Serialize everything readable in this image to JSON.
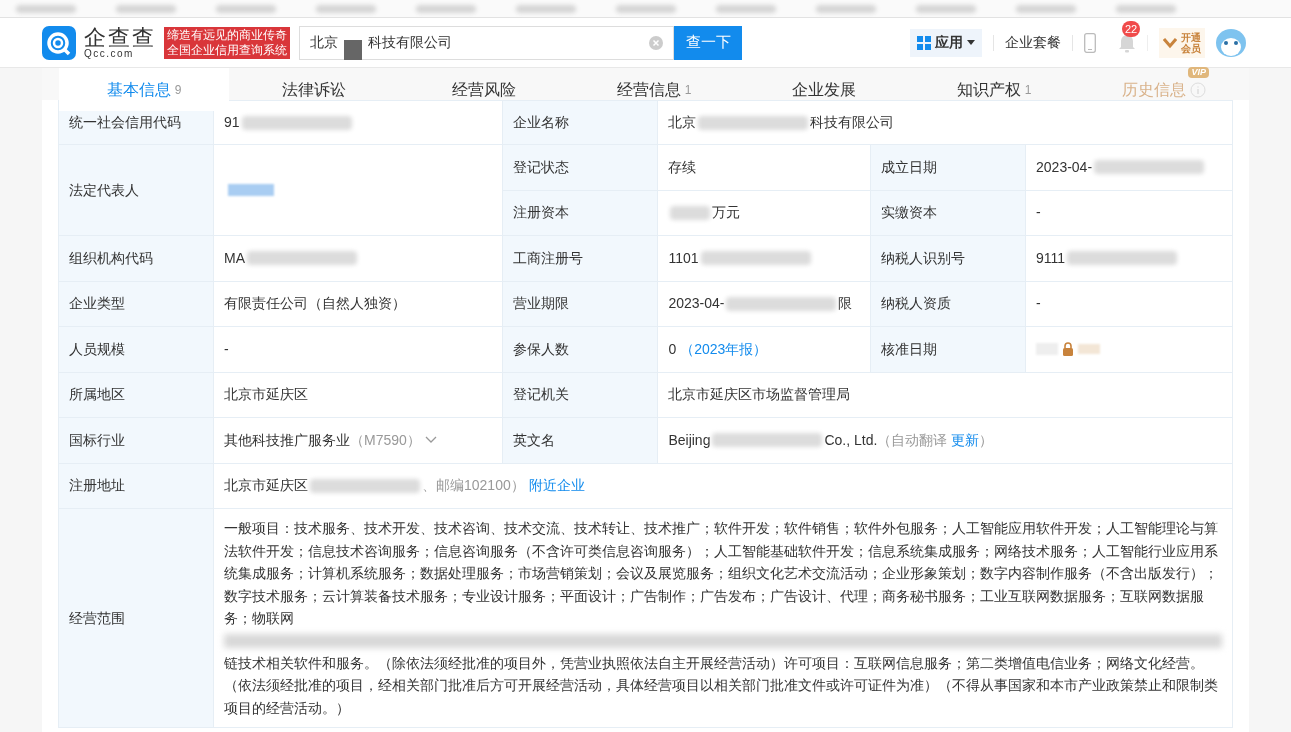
{
  "header": {
    "logo": {
      "name": "企查查",
      "domain": "Qcc.com"
    },
    "slogan": [
      "缔造有远见的商业传奇",
      "全国企业信用查询系统"
    ],
    "search": {
      "parts": [
        {
          "kind": "text",
          "text": "北京"
        },
        {
          "kind": "redacted"
        },
        {
          "kind": "text",
          "text": "科技有限公司"
        }
      ],
      "button": "查一下"
    },
    "apps": "应用",
    "package": "企业套餐",
    "notifications": "22",
    "member": [
      "开通",
      "会员"
    ]
  },
  "tabs": [
    {
      "label": "基本信息",
      "count": "9",
      "selected": true,
      "kind": "plain"
    },
    {
      "label": "法律诉讼",
      "selected": false,
      "kind": "plain"
    },
    {
      "label": "经营风险",
      "selected": false,
      "kind": "plain"
    },
    {
      "label": "经营信息",
      "count": "1",
      "selected": false,
      "kind": "plain"
    },
    {
      "label": "企业发展",
      "selected": false,
      "kind": "plain"
    },
    {
      "label": "知识产权",
      "count": "1",
      "selected": false,
      "kind": "plain"
    },
    {
      "label": "历史信息",
      "badge": "VIP",
      "selected": false,
      "kind": "vip"
    }
  ],
  "rows": [
    {
      "kind": "normal",
      "cells": [
        {
          "kind": "label",
          "text": "统一社会信用代码"
        },
        {
          "kind": "value",
          "parts": [
            {
              "kind": "text",
              "text": "91"
            },
            {
              "kind": "redacted"
            }
          ]
        },
        {
          "kind": "label",
          "text": "企业名称"
        },
        {
          "kind": "value",
          "parts": [
            {
              "kind": "text",
              "text": "北京"
            },
            {
              "kind": "redacted"
            },
            {
              "kind": "text",
              "text": "科技有限公司"
            }
          ]
        }
      ]
    },
    {
      "kind": "split",
      "cells": [
        {
          "kind": "label",
          "text": "法定代表人"
        },
        {
          "kind": "value",
          "parts": [
            {
              "kind": "person"
            }
          ]
        },
        {
          "kind": "label",
          "text": "登记状态"
        },
        {
          "kind": "value",
          "parts": [
            {
              "kind": "text",
              "text": "存续"
            }
          ]
        },
        {
          "kind": "label",
          "text": "成立日期"
        },
        {
          "kind": "value",
          "parts": [
            {
              "kind": "text",
              "text": "2023-04-"
            },
            {
              "kind": "redacted"
            }
          ]
        }
      ]
    },
    {
      "kind": "continued",
      "cells": [
        {
          "kind": "label",
          "text": "注册资本"
        },
        {
          "kind": "value",
          "parts": [
            {
              "kind": "redacted"
            },
            {
              "kind": "text",
              "text": "万元"
            }
          ]
        },
        {
          "kind": "label",
          "text": "实缴资本"
        },
        {
          "kind": "value",
          "parts": [
            {
              "kind": "text",
              "text": "-"
            }
          ]
        }
      ]
    },
    {
      "kind": "normal",
      "cells": [
        {
          "kind": "label",
          "text": "组织机构代码"
        },
        {
          "kind": "value",
          "parts": [
            {
              "kind": "text",
              "text": "MA"
            },
            {
              "kind": "redacted"
            }
          ]
        },
        {
          "kind": "label",
          "text": "工商注册号"
        },
        {
          "kind": "value",
          "parts": [
            {
              "kind": "text",
              "text": "1101"
            },
            {
              "kind": "redacted"
            }
          ]
        },
        {
          "kind": "label",
          "text": "纳税人识别号"
        },
        {
          "kind": "value",
          "parts": [
            {
              "kind": "text",
              "text": "9111"
            },
            {
              "kind": "redacted"
            }
          ]
        }
      ]
    },
    {
      "kind": "normal",
      "cells": [
        {
          "kind": "label",
          "text": "企业类型"
        },
        {
          "kind": "value",
          "parts": [
            {
              "kind": "text",
              "text": "有限责任公司（自然人独资）"
            }
          ]
        },
        {
          "kind": "label",
          "text": "营业期限"
        },
        {
          "kind": "value",
          "parts": [
            {
              "kind": "text",
              "text": "2023-04-"
            },
            {
              "kind": "redacted"
            },
            {
              "kind": "text",
              "text": "限"
            }
          ]
        },
        {
          "kind": "label",
          "text": "纳税人资质"
        },
        {
          "kind": "value",
          "parts": [
            {
              "kind": "text",
              "text": "-"
            }
          ]
        }
      ]
    },
    {
      "kind": "normal",
      "cells": [
        {
          "kind": "label",
          "text": "人员规模"
        },
        {
          "kind": "value",
          "parts": [
            {
              "kind": "text",
              "text": "-"
            }
          ]
        },
        {
          "kind": "label",
          "text": "参保人数"
        },
        {
          "kind": "value",
          "parts": [
            {
              "kind": "text",
              "text": "0"
            },
            {
              "kind": "link",
              "text": "（2023年报）"
            }
          ]
        },
        {
          "kind": "label",
          "text": "核准日期"
        },
        {
          "kind": "value",
          "parts": [
            {
              "kind": "lock"
            }
          ]
        }
      ]
    },
    {
      "kind": "normal",
      "cells": [
        {
          "kind": "label",
          "text": "所属地区"
        },
        {
          "kind": "value",
          "parts": [
            {
              "kind": "text",
              "text": "北京市延庆区"
            }
          ]
        },
        {
          "kind": "label",
          "text": "登记机关"
        },
        {
          "kind": "value",
          "parts": [
            {
              "kind": "text",
              "text": "北京市延庆区市场监督管理局"
            }
          ]
        }
      ]
    },
    {
      "kind": "normal",
      "cells": [
        {
          "kind": "label",
          "text": "国标行业"
        },
        {
          "kind": "value",
          "parts": [
            {
              "kind": "text",
              "text": "其他科技推广服务业"
            },
            {
              "kind": "muted",
              "text": "（M7590）"
            },
            {
              "kind": "caret"
            }
          ]
        },
        {
          "kind": "label",
          "text": "英文名"
        },
        {
          "kind": "value",
          "parts": [
            {
              "kind": "text",
              "text": "Beijing"
            },
            {
              "kind": "redacted"
            },
            {
              "kind": "text",
              "text": "Co., Ltd."
            },
            {
              "kind": "muted",
              "text": "（自动翻译"
            },
            {
              "kind": "link",
              "text": "更新"
            },
            {
              "kind": "muted",
              "text": "）"
            }
          ]
        }
      ]
    },
    {
      "kind": "normal",
      "cells": [
        {
          "kind": "label",
          "text": "注册地址"
        },
        {
          "kind": "value",
          "parts": [
            {
              "kind": "text",
              "text": "北京市延庆区"
            },
            {
              "kind": "redacted"
            },
            {
              "kind": "muted",
              "text": "、邮编102100）"
            },
            {
              "kind": "link",
              "text": "附近企业"
            }
          ]
        }
      ]
    },
    {
      "kind": "normal",
      "cells": [
        {
          "kind": "label",
          "text": "经营范围"
        },
        {
          "kind": "value",
          "parts": [
            {
              "kind": "paragraph",
              "text": "一般项目：技术服务、技术开发、技术咨询、技术交流、技术转让、技术推广；软件开发；软件销售；软件外包服务；人工智能应用软件开发；人工智能理论与算法软件开发；信息技术咨询服务；信息咨询服务（不含许可类信息咨询服务）；人工智能基础软件开发；信息系统集成服务；网络技术服务；人工智能行业应用系统集成服务；计算机系统服务；数据处理服务；市场营销策划；会议及展览服务；组织文化艺术交流活动；企业形象策划；数字内容制作服务（不含出版发行）；数字技术服务；云计算装备技术服务；专业设计服务；平面设计；广告制作；广告发布；广告设计、代理；商务秘书服务；工业互联网数据服务；互联网数据服务；物联网"
            },
            {
              "kind": "redacted-line"
            },
            {
              "kind": "paragraph",
              "text": "链技术相关软件和服务。（除依法须经批准的项目外，凭营业执照依法自主开展经营活动）许可项目：互联网信息服务；第二类增值电信业务；网络文化经营。（依法须经批准的项目，经相关部门批准后方可开展经营活动，具体经营项目以相关部门批准文件或许可证件为准）（不得从事国家和本市产业政策禁止和限制类项目的经营活动。）"
            }
          ]
        }
      ]
    }
  ]
}
